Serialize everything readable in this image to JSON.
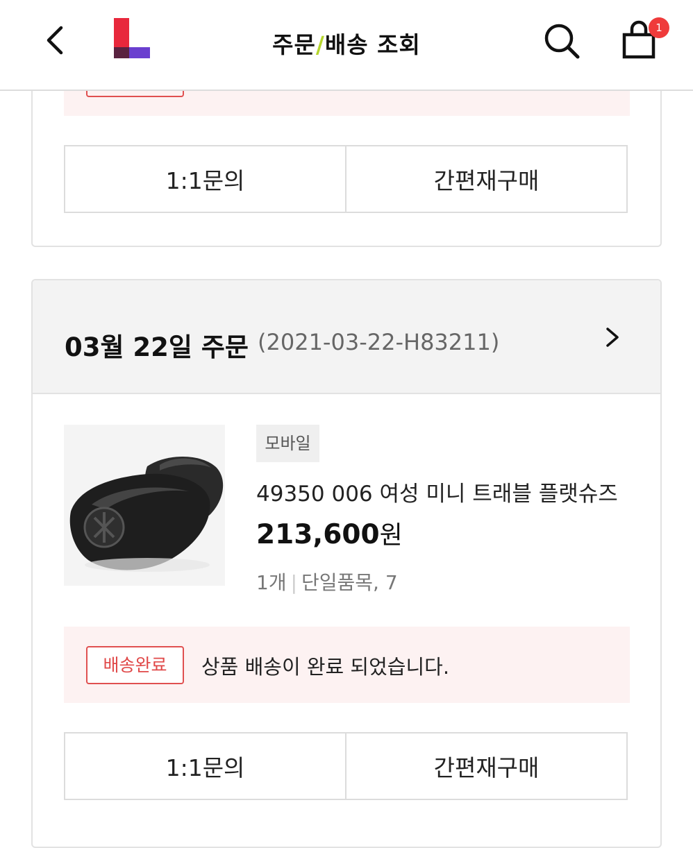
{
  "header": {
    "title_part1": "주문",
    "title_slash": "/",
    "title_part2": "배송 조회",
    "cart_count": "1",
    "icons": {
      "back": "chevron-left-icon",
      "search": "search-icon",
      "cart": "shopping-bag-icon",
      "logo": "brand-logo"
    },
    "colors": {
      "logo_red": "#e8283c",
      "logo_purple": "#6a3fcf",
      "title_slash": "#b6d62e",
      "badge": "#ef3b3b"
    }
  },
  "orders": [
    {
      "actions": {
        "inquiry": "1:1문의",
        "reorder": "간편재구매"
      }
    },
    {
      "date_label": "03월 22일 주문",
      "order_number": "(2021-03-22-H83211)",
      "item": {
        "channel": "모바일",
        "name": "49350 006 여성 미니 트래블 플랫슈즈",
        "price_number": "213,600",
        "price_unit": "원",
        "quantity": "1개",
        "option": "단일품목, 7",
        "image": "black-ballet-flat-shoe-image"
      },
      "status": {
        "badge": "배송완료",
        "message": "상품 배송이 완료 되었습니다."
      },
      "actions": {
        "inquiry": "1:1문의",
        "reorder": "간편재구매"
      }
    }
  ],
  "colors": {
    "status_red": "#e04848",
    "notice_bg": "#fdf2f2",
    "head_bg": "#f3f3f3"
  }
}
